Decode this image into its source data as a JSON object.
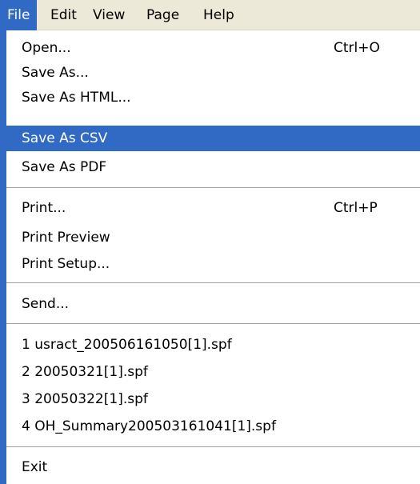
{
  "menubar": {
    "items": [
      {
        "label": "File"
      },
      {
        "label": "Edit"
      },
      {
        "label": "View"
      },
      {
        "label": "Page"
      },
      {
        "label": "Help"
      }
    ]
  },
  "file_menu": {
    "open": {
      "label": "Open...",
      "shortcut": "Ctrl+O"
    },
    "save_as": {
      "label": "Save As..."
    },
    "save_as_html": {
      "label": "Save As HTML..."
    },
    "save_as_csv": {
      "label": "Save As CSV"
    },
    "save_as_pdf": {
      "label": "Save As PDF"
    },
    "print": {
      "label": "Print...",
      "shortcut": "Ctrl+P"
    },
    "print_preview": {
      "label": "Print Preview"
    },
    "print_setup": {
      "label": "Print Setup..."
    },
    "send": {
      "label": "Send..."
    },
    "recent_files": [
      {
        "label": "1 usract_200506161050[1].spf"
      },
      {
        "label": "2 20050321[1].spf"
      },
      {
        "label": "3 20050322[1].spf"
      },
      {
        "label": "4 OH_Summary200503161041[1].spf"
      }
    ],
    "exit": {
      "label": "Exit"
    }
  },
  "colors": {
    "highlight": "#316ac5",
    "menubar_bg": "#ece9d8",
    "separator": "#a0a0a0"
  }
}
